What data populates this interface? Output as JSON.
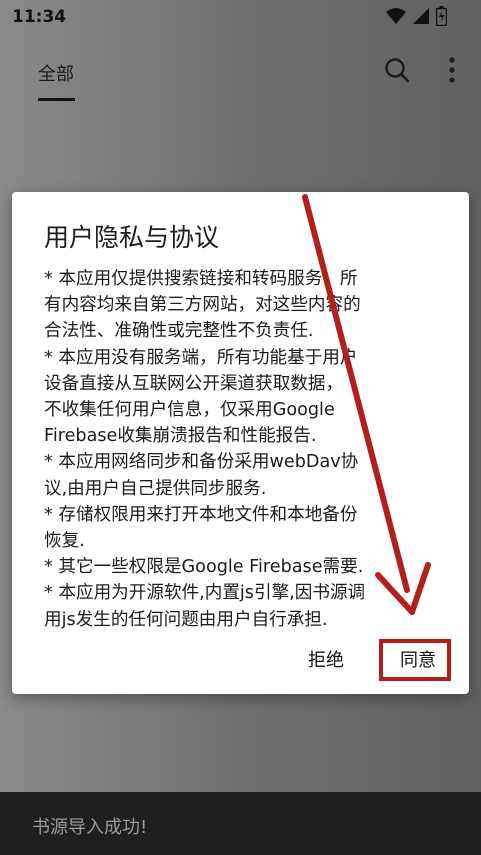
{
  "status_bar": {
    "time": "11:34"
  },
  "top_bar": {
    "tab_all": "全部"
  },
  "dialog": {
    "title": "用户隐私与协议",
    "lines": [
      "* 本应用仅提供搜索链接和转码服务，所",
      "有内容均来自第三方网站，对这些内容的",
      "合法性、准确性或完整性不负责任.",
      "* 本应用没有服务端，所有功能基于用户",
      "设备直接从互联网公开渠道获取数据，",
      "不收集任何用户信息，仅采用Google",
      "Firebase收集崩溃报告和性能报告.",
      "* 本应用网络同步和备份采用webDav协",
      "议,由用户自己提供同步服务.",
      "* 存储权限用来打开本地文件和本地备份",
      "恢复.",
      "* 其它一些权限是Google Firebase需要.",
      "* 本应用为开源软件,内置js引擎,因书源调",
      "用js发生的任何问题由用户自行承担."
    ],
    "refuse_label": "拒绝",
    "agree_label": "同意"
  },
  "toast": {
    "text": "书源导入成功!"
  },
  "colors": {
    "annotation_red": "#b1201c"
  }
}
